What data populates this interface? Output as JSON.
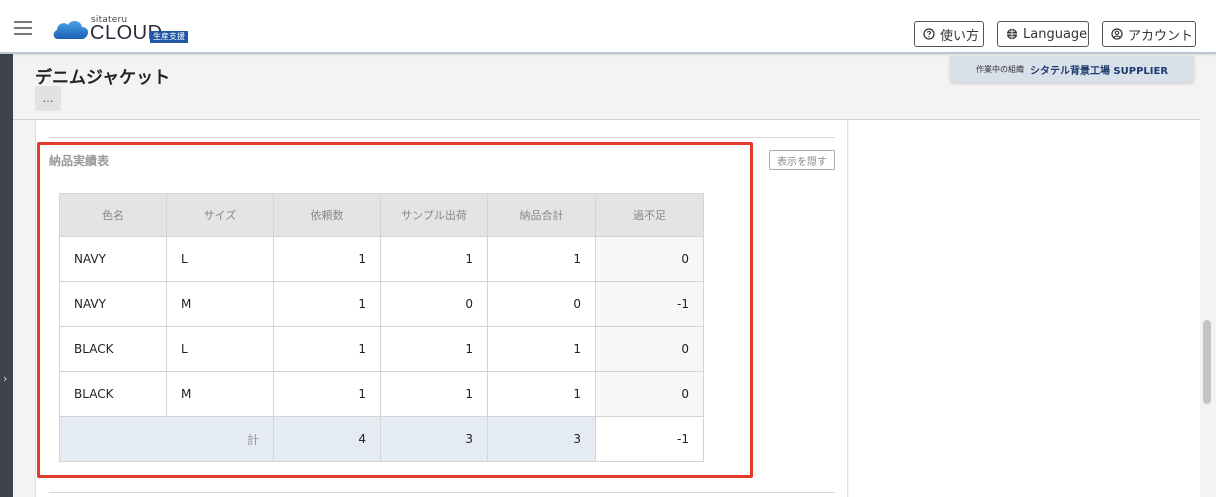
{
  "header": {
    "logo": {
      "small": "sitateru",
      "main": "CLOUD",
      "badge": "生産支援"
    },
    "help_label": "使い方",
    "language_label": "Language",
    "account_label": "アカウント"
  },
  "org": {
    "label": "作業中の組織",
    "name": "シタテル背景工場 SUPPLIER"
  },
  "page": {
    "title": "デニムジャケット",
    "more_label": "…"
  },
  "section": {
    "title": "納品実績表",
    "hide_label": "表示を隠す"
  },
  "table": {
    "headers": [
      "色名",
      "サイズ",
      "依頼数",
      "サンプル出荷",
      "納品合計",
      "過不足"
    ],
    "rows": [
      {
        "color": "NAVY",
        "size": "L",
        "requested": "1",
        "sample": "1",
        "delivered": "1",
        "diff": "0"
      },
      {
        "color": "NAVY",
        "size": "M",
        "requested": "1",
        "sample": "0",
        "delivered": "0",
        "diff": "-1"
      },
      {
        "color": "BLACK",
        "size": "L",
        "requested": "1",
        "sample": "1",
        "delivered": "1",
        "diff": "0"
      },
      {
        "color": "BLACK",
        "size": "M",
        "requested": "1",
        "sample": "1",
        "delivered": "1",
        "diff": "0"
      }
    ],
    "total": {
      "label": "計",
      "requested": "4",
      "sample": "3",
      "delivered": "3",
      "diff": "-1"
    }
  },
  "colors": {
    "accent": "#1f57a4",
    "negative": "#e23b2c",
    "highlight_border": "#e23b2c"
  },
  "icons": {
    "menu": "hamburger-icon",
    "help": "question-circle-icon",
    "language": "globe-icon",
    "account": "user-circle-icon",
    "sidebar_toggle": "chevron-right-icon"
  }
}
